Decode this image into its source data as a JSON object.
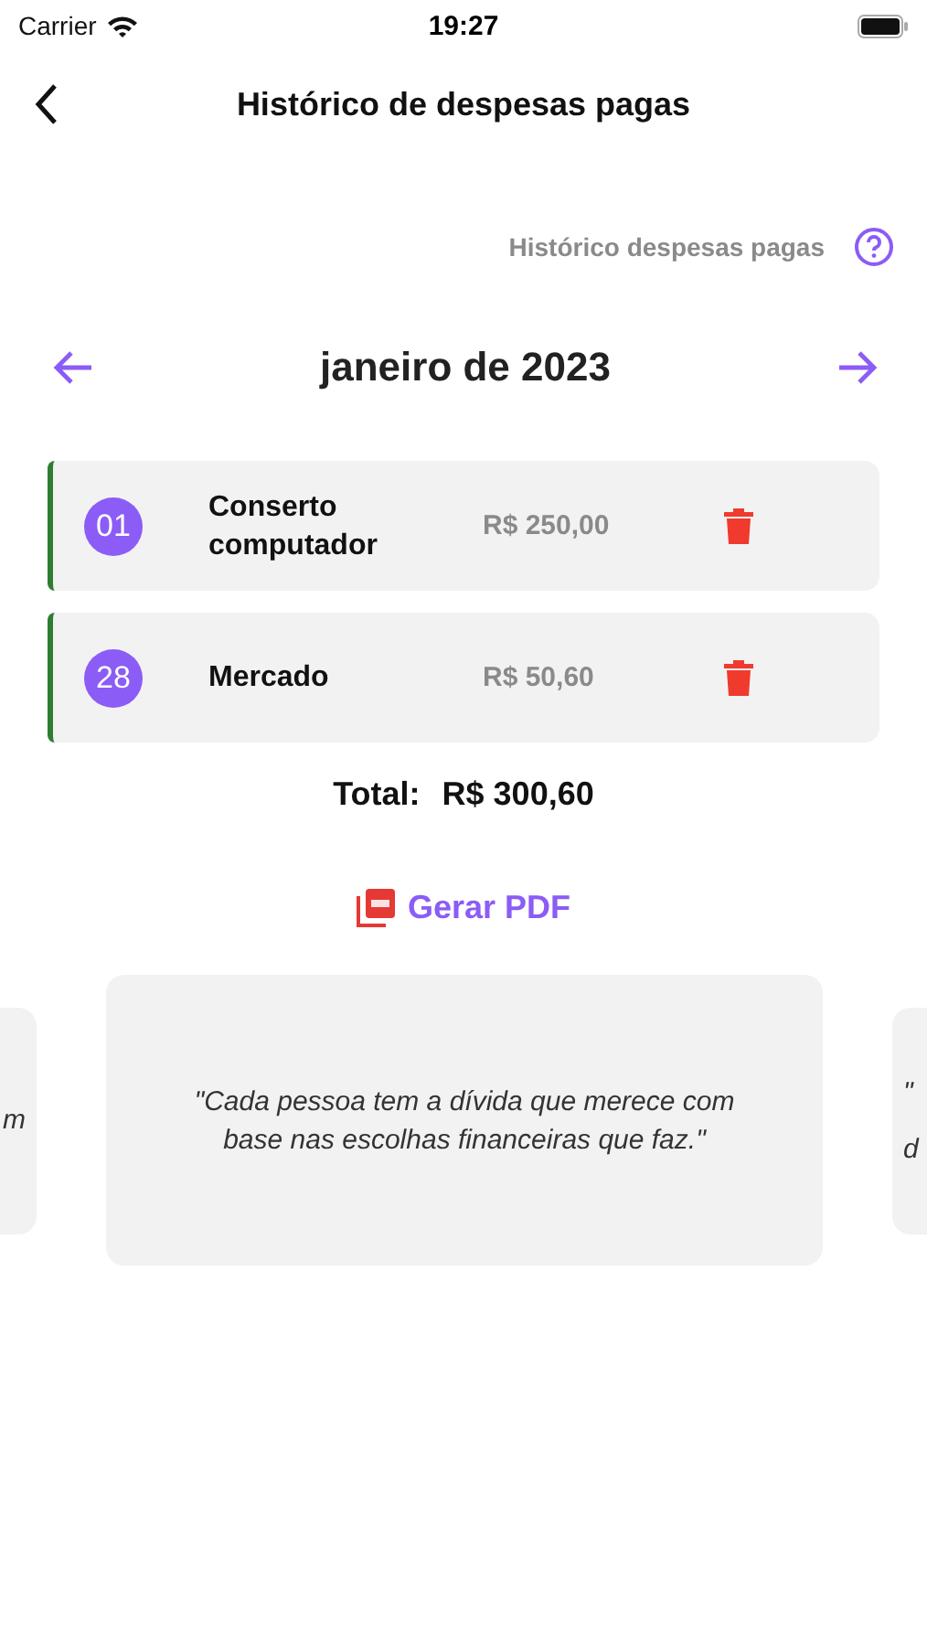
{
  "status_bar": {
    "carrier": "Carrier",
    "time": "19:27"
  },
  "nav": {
    "title": "Histórico de despesas pagas"
  },
  "help": {
    "label": "Histórico despesas pagas"
  },
  "month": {
    "label": "janeiro de 2023"
  },
  "expenses": [
    {
      "day": "01",
      "name": "Conserto computador",
      "amount": "R$ 250,00"
    },
    {
      "day": "28",
      "name": "Mercado",
      "amount": "R$ 50,60"
    }
  ],
  "total": {
    "label": "Total:",
    "value": "R$ 300,60"
  },
  "pdf_button": {
    "label": "Gerar PDF"
  },
  "quotes": [
    {
      "lines": [
        "m"
      ]
    },
    {
      "lines": [
        "\"Cada pessoa tem a dívida que merece com base nas escolhas financeiras que faz.\""
      ]
    },
    {
      "lines": [
        "\"",
        "d"
      ]
    }
  ]
}
